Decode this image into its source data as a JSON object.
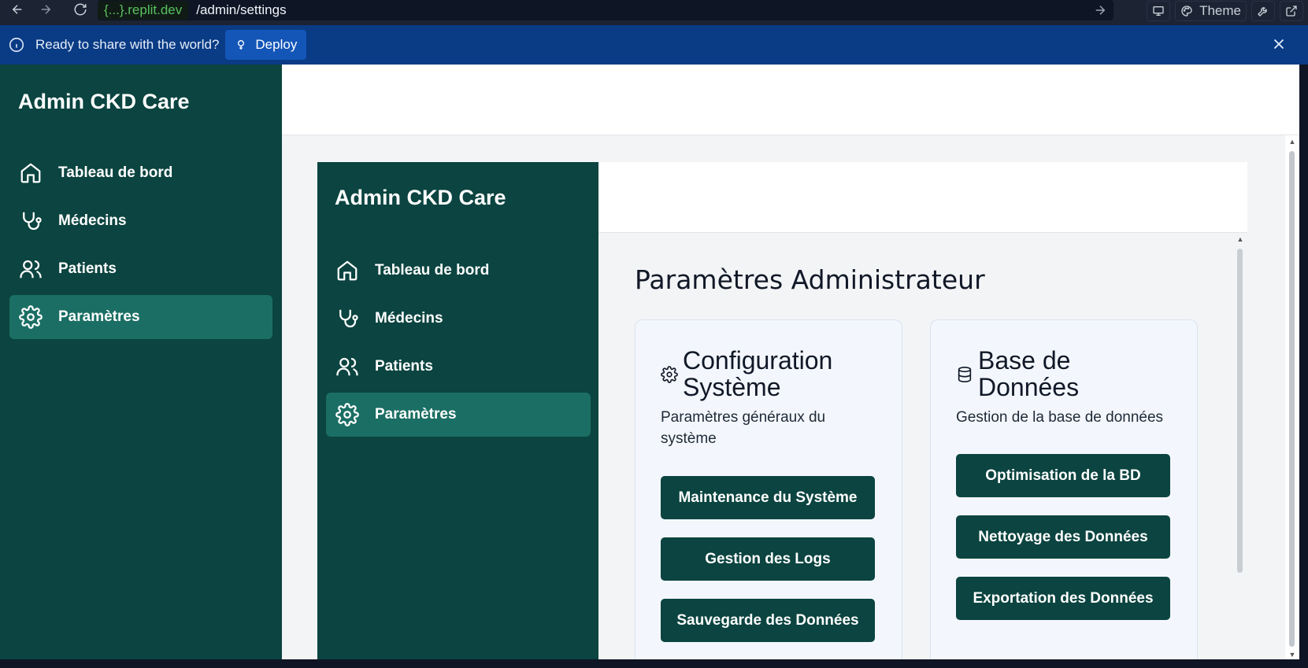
{
  "browser": {
    "url_host": "{...}.replit.dev",
    "url_path": "/admin/settings",
    "theme_label": "Theme"
  },
  "deploy_bar": {
    "message": "Ready to share with the world?",
    "deploy_label": "Deploy"
  },
  "app": {
    "brand": "Admin CKD Care",
    "nav": [
      {
        "label": "Tableau de bord",
        "icon": "home-icon",
        "active": false
      },
      {
        "label": "Médecins",
        "icon": "stethoscope-icon",
        "active": false
      },
      {
        "label": "Patients",
        "icon": "users-icon",
        "active": false
      },
      {
        "label": "Paramètres",
        "icon": "gear-icon",
        "active": true
      }
    ]
  },
  "page": {
    "title": "Paramètres Administrateur",
    "cards": [
      {
        "title": "Configuration Système",
        "icon": "gear-icon",
        "description": "Paramètres généraux du système",
        "buttons": [
          "Maintenance du Système",
          "Gestion des Logs",
          "Sauvegarde des Données"
        ]
      },
      {
        "title": "Base de Données",
        "icon": "database-icon",
        "description": "Gestion de la base de données",
        "buttons": [
          "Optimisation de la BD",
          "Nettoyage des Données",
          "Exportation des Données"
        ]
      }
    ]
  },
  "colors": {
    "sidebar": "#0b4440",
    "active_nav": "#1b6e64",
    "deploy_bar": "#0a3b85",
    "primary_button": "#0b4440"
  }
}
